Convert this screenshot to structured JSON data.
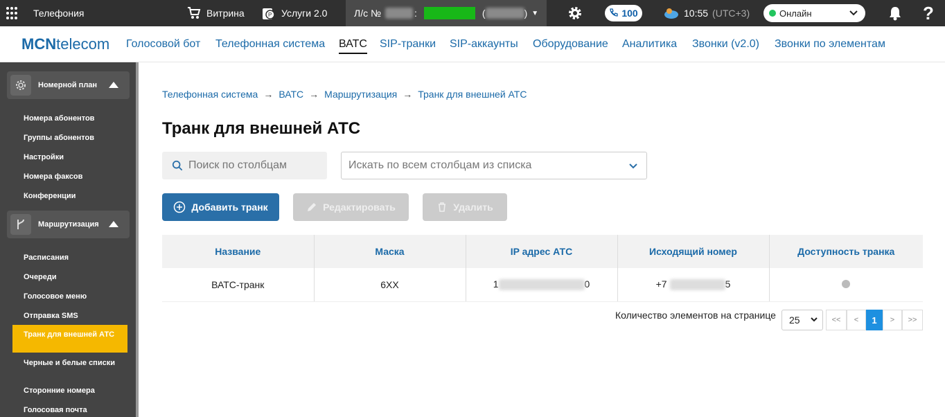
{
  "top": {
    "app": "Телефония",
    "showcase": "Витрина",
    "services": "Услуги 2.0",
    "account_label": "Л/с №",
    "colon": ":",
    "paren_open": "(",
    "paren_close": ")",
    "calls_count": "100",
    "time": "10:55",
    "tz": "(UTC+3)",
    "status": "Онлайн"
  },
  "nav": {
    "logo_bold": "MCN",
    "logo_rest": "telecom",
    "items": [
      "Голосовой бот",
      "Телефонная система",
      "ВАТС",
      "SIP-транки",
      "SIP-аккаунты",
      "Оборудование",
      "Аналитика",
      "Звонки (v2.0)",
      "Звонки по элементам"
    ]
  },
  "sidebar": {
    "section1": "Номерной план",
    "section1_items": [
      "Номера абонентов",
      "Группы абонентов",
      "Настройки",
      "Номера факсов",
      "Конференции"
    ],
    "section2": "Маршрутизация",
    "section2_items": [
      "Расписания",
      "Очереди",
      "Голосовое меню",
      "Отправка SMS",
      "Транк для внешней АТС",
      "Черные и белые списки",
      "Сторонние номера",
      "Голосовая почта"
    ]
  },
  "breadcrumb": [
    "Телефонная система",
    "ВАТС",
    "Маршрутизация",
    "Транк для внешней АТС"
  ],
  "title": "Транк для внешней АТС",
  "search": {
    "placeholder": "Поиск по столбцам"
  },
  "filter": {
    "placeholder": "Искать по всем столбцам из списка"
  },
  "buttons": {
    "add": "Добавить транк",
    "edit": "Редактировать",
    "delete": "Удалить"
  },
  "table": {
    "headers": [
      "Название",
      "Маска",
      "IP адрес АТС",
      "Исходящий номер",
      "Доступность транка"
    ],
    "row": {
      "name": "ВАТС-транк",
      "mask": "6XX",
      "ip_start": "1",
      "ip_end": "0",
      "num_start": "+7",
      "num_end": "5"
    }
  },
  "pager": {
    "label": "Количество элементов на странице",
    "page_size": "25",
    "first": "<<",
    "prev": "<",
    "current": "1",
    "next": ">",
    "last": ">>"
  },
  "colors": {
    "accent": "#1b6aa8",
    "highlight": "#f5b800",
    "topbar": "#303030"
  }
}
